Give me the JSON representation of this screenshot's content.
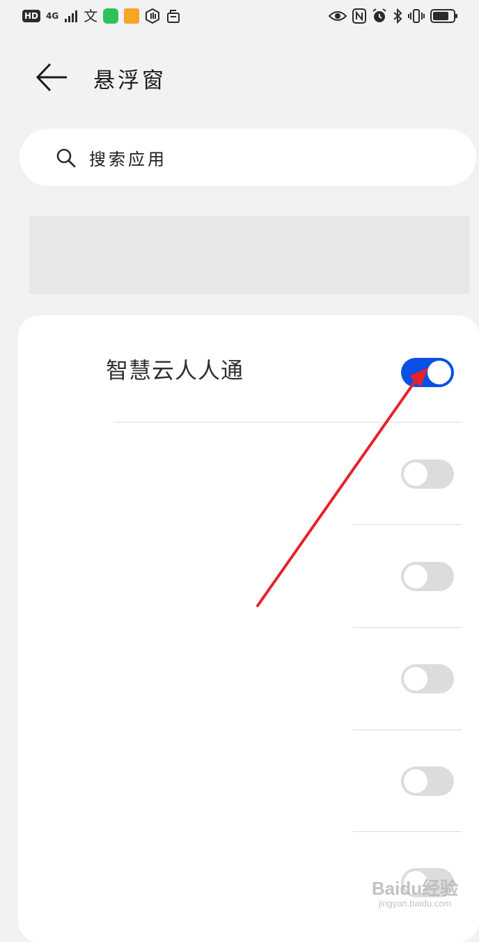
{
  "status_bar": {
    "hd": "HD",
    "network": "4G",
    "icons_left": [
      "hd-badge",
      "4g-signal-icon",
      "signal-bars-icon",
      "text-app-icon",
      "chat-app-icon",
      "shopping-app-icon",
      "hand-icon",
      "briefcase-icon"
    ],
    "icons_right": [
      "eye-icon",
      "nfc-icon",
      "alarm-icon",
      "bluetooth-icon",
      "vibrate-icon",
      "battery-icon"
    ],
    "text_glyph": "文"
  },
  "header": {
    "title": "悬浮窗"
  },
  "search": {
    "placeholder": "搜索应用"
  },
  "apps": [
    {
      "name": "智慧云人人通",
      "enabled": true
    },
    {
      "name": "",
      "enabled": false
    },
    {
      "name": "",
      "enabled": false
    },
    {
      "name": "",
      "enabled": false
    },
    {
      "name": "",
      "enabled": false
    },
    {
      "name": "",
      "enabled": false
    }
  ],
  "watermark": {
    "main": "Baidu经验",
    "sub": "jingyan.baidu.com"
  },
  "colors": {
    "background": "#f1f2f4",
    "toggle_on": "#0a50e6",
    "toggle_off": "#dcdcdc",
    "annotation_arrow": "#e8212a"
  }
}
